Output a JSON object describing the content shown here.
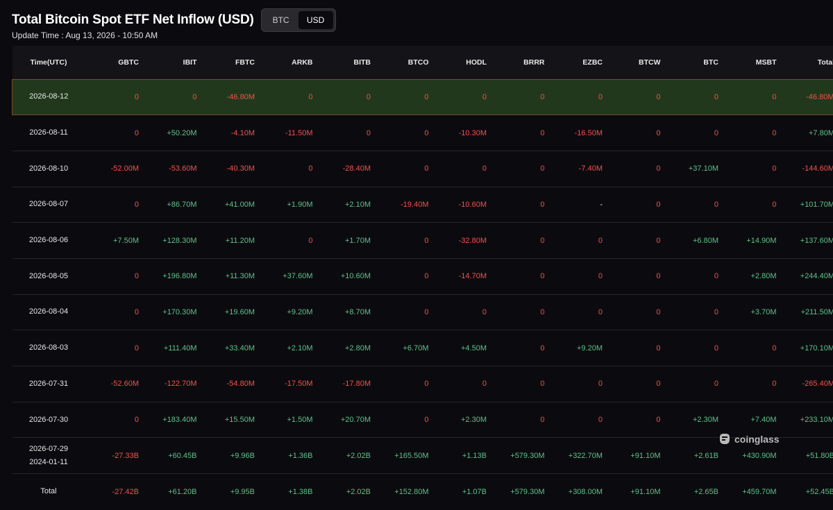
{
  "header": {
    "title": "Total Bitcoin Spot ETF Net Inflow (USD)",
    "toggle": [
      "BTC",
      "USD"
    ],
    "active": "USD",
    "update_time": "Update Time : Aug 13, 2026 - 10:50 AM"
  },
  "table": {
    "columns": [
      "Time(UTC)",
      "GBTC",
      "IBIT",
      "FBTC",
      "ARKB",
      "BITB",
      "BTCO",
      "HODL",
      "BRRR",
      "EZBC",
      "BTCW",
      "BTC",
      "MSBT",
      "Total"
    ],
    "rows": [
      {
        "time": [
          "2026-08-12"
        ],
        "highlight": true,
        "cells": [
          "0",
          "0",
          "-46.80M",
          "0",
          "0",
          "0",
          "0",
          "0",
          "0",
          "0",
          "0",
          "0",
          "-46.80M"
        ]
      },
      {
        "time": [
          "2026-08-11"
        ],
        "cells": [
          "0",
          "+50.20M",
          "-4.10M",
          "-11.50M",
          "0",
          "0",
          "-10.30M",
          "0",
          "-16.50M",
          "0",
          "0",
          "0",
          "+7.80M"
        ]
      },
      {
        "time": [
          "2026-08-10"
        ],
        "cells": [
          "-52.00M",
          "-53.60M",
          "-40.30M",
          "0",
          "-28.40M",
          "0",
          "0",
          "0",
          "-7.40M",
          "0",
          "+37.10M",
          "0",
          "-144.60M"
        ]
      },
      {
        "time": [
          "2026-08-07"
        ],
        "cells": [
          "0",
          "+86.70M",
          "+41.00M",
          "+1.90M",
          "+2.10M",
          "-19.40M",
          "-10.60M",
          "0",
          "-",
          "0",
          "0",
          "0",
          "+101.70M"
        ]
      },
      {
        "time": [
          "2026-08-06"
        ],
        "cells": [
          "+7.50M",
          "+128.30M",
          "+11.20M",
          "0",
          "+1.70M",
          "0",
          "-32.80M",
          "0",
          "0",
          "0",
          "+6.80M",
          "+14.90M",
          "+137.60M"
        ]
      },
      {
        "time": [
          "2026-08-05"
        ],
        "cells": [
          "0",
          "+196.80M",
          "+11.30M",
          "+37.60M",
          "+10.60M",
          "0",
          "-14.70M",
          "0",
          "0",
          "0",
          "0",
          "+2.80M",
          "+244.40M"
        ]
      },
      {
        "time": [
          "2026-08-04"
        ],
        "cells": [
          "0",
          "+170.30M",
          "+19.60M",
          "+9.20M",
          "+8.70M",
          "0",
          "0",
          "0",
          "0",
          "0",
          "0",
          "+3.70M",
          "+211.50M"
        ]
      },
      {
        "time": [
          "2026-08-03"
        ],
        "cells": [
          "0",
          "+111.40M",
          "+33.40M",
          "+2.10M",
          "+2.80M",
          "+6.70M",
          "+4.50M",
          "0",
          "+9.20M",
          "0",
          "0",
          "0",
          "+170.10M"
        ]
      },
      {
        "time": [
          "2026-07-31"
        ],
        "cells": [
          "-52.60M",
          "-122.70M",
          "-54.80M",
          "-17.50M",
          "-17.80M",
          "0",
          "0",
          "0",
          "0",
          "0",
          "0",
          "0",
          "-265.40M"
        ]
      },
      {
        "time": [
          "2026-07-30"
        ],
        "cells": [
          "0",
          "+183.40M",
          "+15.50M",
          "+1.50M",
          "+20.70M",
          "0",
          "+2.30M",
          "0",
          "0",
          "0",
          "+2.30M",
          "+7.40M",
          "+233.10M"
        ]
      },
      {
        "time": [
          "2026-07-29",
          "2024-01-11"
        ],
        "cells": [
          "-27.33B",
          "+60.45B",
          "+9.96B",
          "+1.36B",
          "+2.02B",
          "+165.50M",
          "+1.13B",
          "+579.30M",
          "+322.70M",
          "+91.10M",
          "+2.61B",
          "+430.90M",
          "+51.80B"
        ]
      },
      {
        "time": [
          "Total"
        ],
        "cells": [
          "-27.42B",
          "+61.20B",
          "+9.95B",
          "+1.38B",
          "+2.02B",
          "+152.80M",
          "+1.07B",
          "+579.30M",
          "+308.00M",
          "+91.10M",
          "+2.65B",
          "+459.70M",
          "+52.45B"
        ]
      }
    ]
  },
  "watermark": "coinglass",
  "colors": {
    "positive": "#5fc08a",
    "negative": "#f0514e",
    "highlight_bg": "#22381c",
    "highlight_border": "#7a4b27"
  }
}
